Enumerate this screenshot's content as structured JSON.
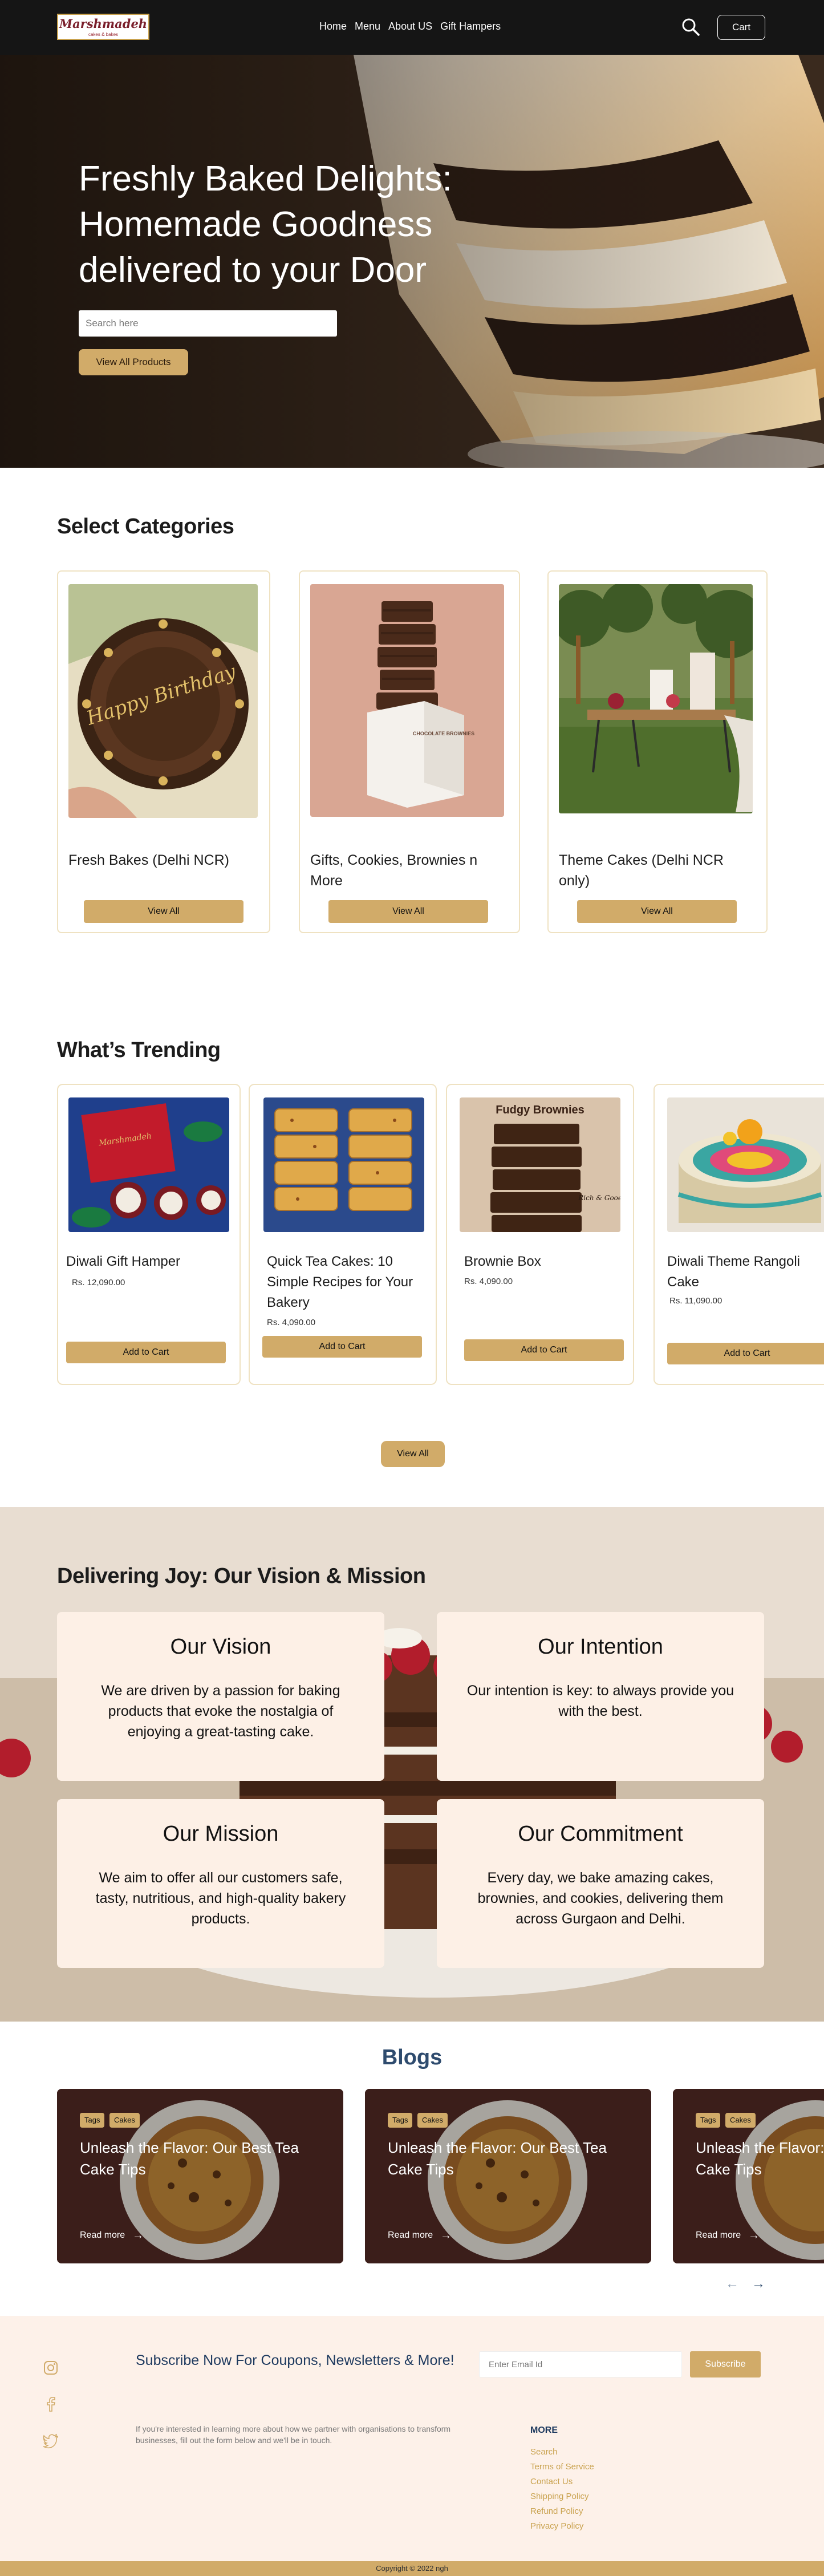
{
  "nav": {
    "logo_text": "Marshmadeh",
    "logo_tagline": "cakes & bakes",
    "links": [
      "Home",
      "Menu",
      "About US",
      "Gift Hampers"
    ],
    "cart_label": "Cart"
  },
  "hero": {
    "title": "Freshly Baked Delights: Homemade Goodness delivered to your Door",
    "search_placeholder": "Search here",
    "button_label": "View All Products"
  },
  "categories": {
    "title": "Select Categories",
    "items": [
      {
        "name": "Fresh Bakes (Delhi NCR)",
        "button": "View All",
        "cake_text": "Happy Birthday"
      },
      {
        "name": "Gifts, Cookies, Brownies n More",
        "button": "View All",
        "box_text": "CHOCOLATE BROWNIES"
      },
      {
        "name": "Theme Cakes (Delhi NCR only)",
        "button": "View All"
      }
    ]
  },
  "trending": {
    "title": "What’s Trending",
    "items": [
      {
        "name": "Diwali Gift Hamper",
        "price": "Rs. 12,090.00",
        "button": "Add to Cart",
        "box_text": "Marshmadeh"
      },
      {
        "name": "Quick Tea Cakes: 10 Simple Recipes for  Your Bakery",
        "price": "Rs. 4,090.00",
        "button": "Add to Cart"
      },
      {
        "name": "Brownie Box",
        "price": "Rs. 4,090.00",
        "button": "Add to Cart",
        "img_caption": "Fudgy Brownies",
        "img_sub": "Rich & Gooey"
      },
      {
        "name": "Diwali Theme Rangoli Cake",
        "price": "Rs. 11,090.00",
        "button": "Add to Cart"
      }
    ],
    "view_all": "View All"
  },
  "vision": {
    "title": "Delivering Joy: Our Vision & Mission",
    "cards": [
      {
        "heading": "Our Vision",
        "text": "We are driven by a passion for baking products that evoke the nostalgia of enjoying a great-tasting cake."
      },
      {
        "heading": "Our Intention",
        "text": "Our intention is key: to always provide you with the best."
      },
      {
        "heading": "Our Mission",
        "text": "We aim to offer all our customers safe, tasty, nutritious, and high-quality bakery products."
      },
      {
        "heading": "Our Commitment",
        "text": "Every day, we bake amazing cakes, brownies, and cookies, delivering them across Gurgaon and Delhi."
      }
    ]
  },
  "blogs": {
    "title": "Blogs",
    "tags": [
      "Tags",
      "Cakes"
    ],
    "posts": [
      {
        "title": "Unleash the Flavor: Our Best Tea Cake Tips",
        "read_more": "Read more"
      },
      {
        "title": "Unleash the Flavor: Our Best Tea Cake Tips",
        "read_more": "Read more"
      },
      {
        "title": "Unleash the Flavor: Our Best Tea Cake Tips",
        "read_more": "Read more"
      }
    ],
    "prev": "←",
    "next": "→"
  },
  "footer": {
    "subscribe_title": "Subscribe Now For Coupons, Newsletters & More!",
    "email_placeholder": "Enter Email Id",
    "subscribe_button": "Subscribe",
    "description": "If you're interested in learning more about how we partner with organisations to transform businesses, fill out the form below and we'll be in touch.",
    "more_title": "MORE",
    "more_links": [
      "Search",
      "Terms of Service",
      "Contact Us",
      "Shipping Policy",
      "Refund Policy",
      "Privacy Policy"
    ],
    "copyright": "Copyright © 2022 ngh"
  },
  "colors": {
    "accent": "#d1ab69",
    "nav_bg": "#151515",
    "card_border": "#efe2c2",
    "vision_card": "#fdf0e6",
    "blog_title": "#2e4b6e",
    "footer_bg": "#fdf1e9"
  },
  "icons": [
    "search-icon",
    "arrow-right-icon",
    "arrow-left-icon",
    "instagram-icon",
    "facebook-icon",
    "twitter-icon"
  ]
}
